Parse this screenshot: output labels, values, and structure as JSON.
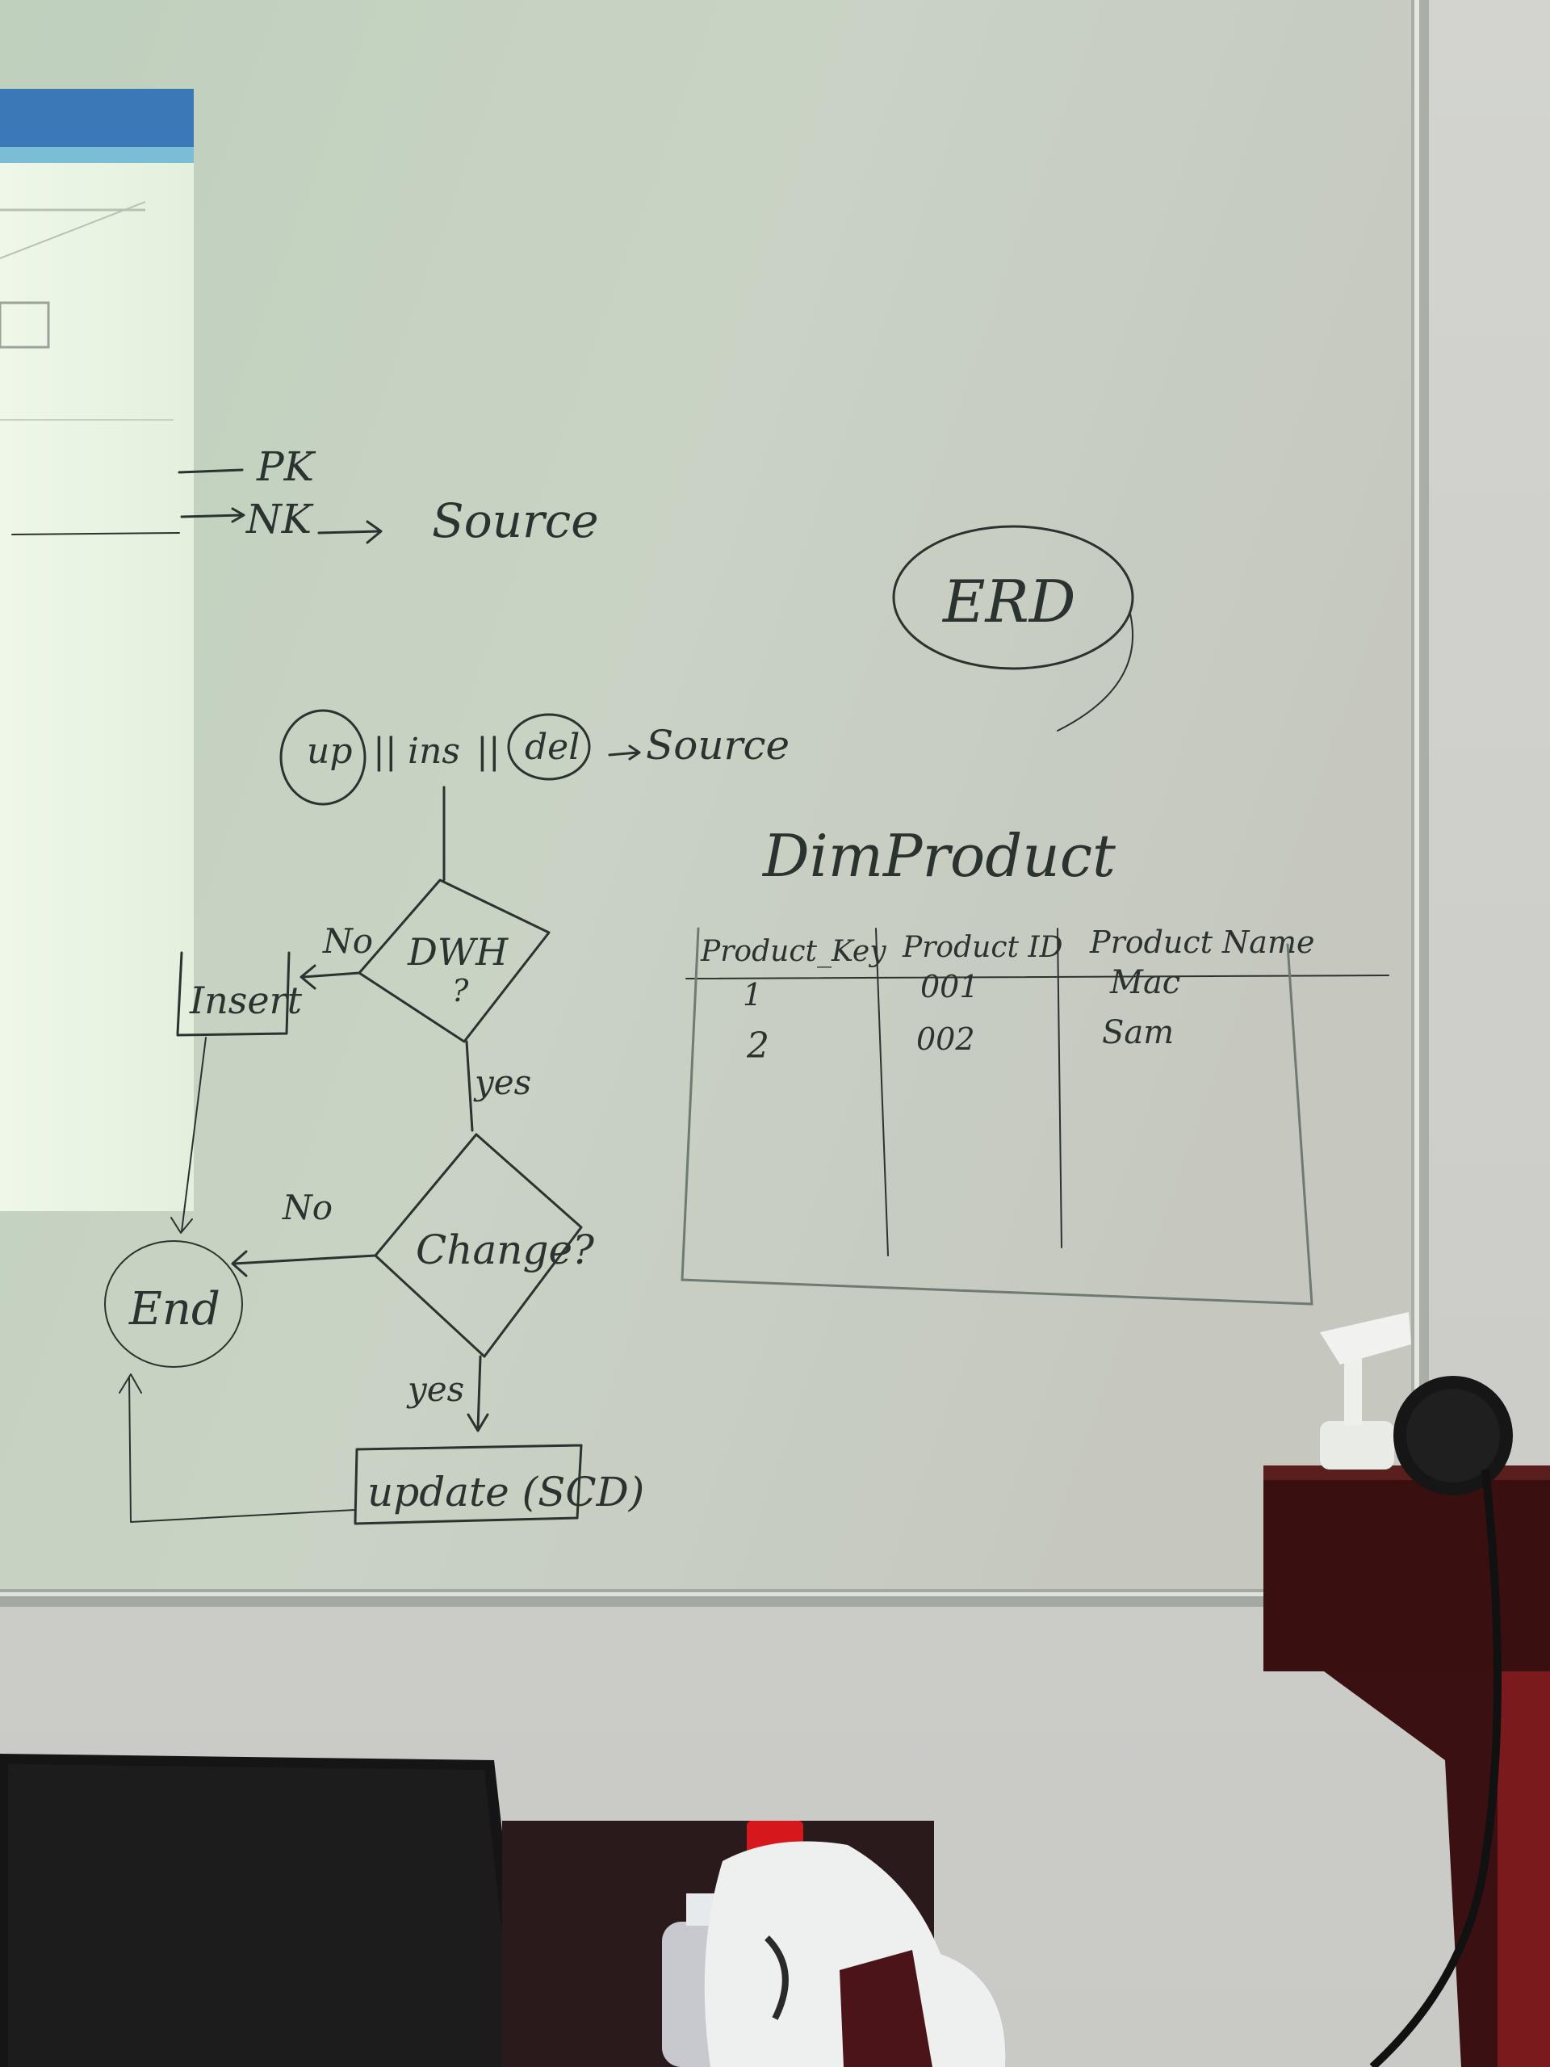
{
  "whiteboard": {
    "keys": {
      "pk": "PK",
      "nk": "NK",
      "nk_target": "Source"
    },
    "erd_label": "ERD",
    "ops": {
      "up": "up",
      "ins": "ins",
      "del": "del",
      "separator": "||",
      "target": "Source"
    },
    "flowchart": {
      "decision_dwh": "DWH",
      "decision_dwh_q": "?",
      "no_label_1": "No",
      "insert_box": "Insert",
      "yes_label_1": "yes",
      "decision_change": "Change?",
      "no_label_2": "No",
      "end_node": "End",
      "yes_label_2": "yes",
      "update_box": "update (SCD)"
    },
    "table": {
      "title": "DimProduct",
      "headers": [
        "Product_Key",
        "Product ID",
        "Product Name"
      ],
      "rows": [
        [
          "1",
          "001",
          "Mac"
        ],
        [
          "2",
          "002",
          "Sam"
        ]
      ]
    }
  }
}
